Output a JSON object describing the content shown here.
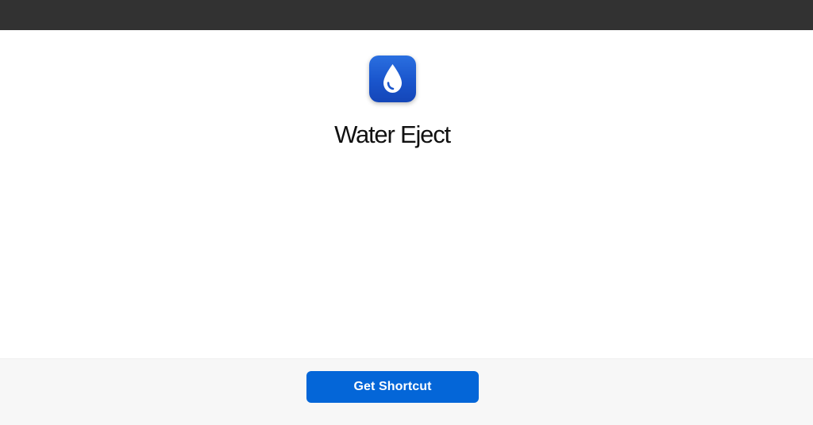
{
  "app": {
    "title": "Water Eject",
    "icon": "water-drop-icon",
    "icon_color": "#1a55cc"
  },
  "footer": {
    "button_label": "Get Shortcut",
    "button_color": "#0466d8"
  }
}
